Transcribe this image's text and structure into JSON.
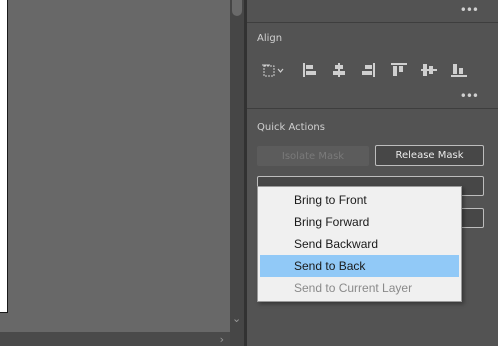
{
  "panel": {
    "align": {
      "title": "Align"
    },
    "quick_actions": {
      "title": "Quick Actions",
      "isolate_mask_label": "Isolate Mask",
      "release_mask_label": "Release Mask"
    }
  },
  "context_menu": {
    "items": [
      {
        "label": "Bring to Front"
      },
      {
        "label": "Bring Forward"
      },
      {
        "label": "Send Backward"
      },
      {
        "label": "Send to Back"
      },
      {
        "label": "Send to Current Layer"
      }
    ]
  },
  "colors": {
    "panel_bg": "#535353",
    "canvas_bg": "#686868",
    "menu_highlight": "#91c9f7"
  },
  "icons": [
    "more-options-icon",
    "align-to-icon",
    "horizontal-align-left-icon",
    "horizontal-align-center-icon",
    "horizontal-align-right-icon",
    "vertical-align-top-icon",
    "vertical-align-center-icon",
    "vertical-align-bottom-icon"
  ]
}
